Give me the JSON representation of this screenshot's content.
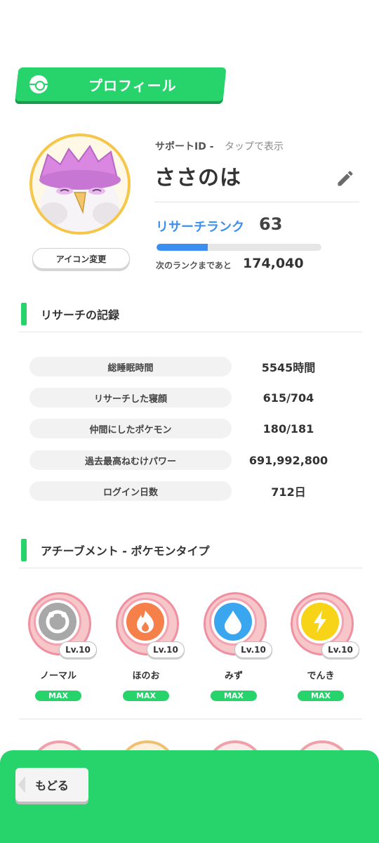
{
  "header": {
    "title": "プロフィール",
    "icon": "pokeball-icon"
  },
  "profile": {
    "support_id_label": "サポートID -",
    "support_id_tap": "タップで表示",
    "name": "ささのは",
    "icon_change_label": "アイコン変更",
    "rank_label": "リサーチランク",
    "rank_value": "63",
    "rank_progress": 0.31,
    "next_rank_label": "次のランクまであと",
    "next_rank_value": "174,040"
  },
  "records": {
    "title": "リサーチの記録",
    "rows": [
      {
        "label": "総睡眠時間",
        "value": "5545時間"
      },
      {
        "label": "リサーチした寝顔",
        "value": "615/704"
      },
      {
        "label": "仲間にしたポケモン",
        "value": "180/181"
      },
      {
        "label": "過去最高ねむけパワー",
        "value": "691,992,800"
      },
      {
        "label": "ログイン日数",
        "value": "712日"
      }
    ]
  },
  "achievements": {
    "title": "アチーブメント - ポケモンタイプ",
    "items": [
      {
        "type": "ノーマル",
        "level": "Lv.10",
        "status": "MAX",
        "color": "#a8a8a8",
        "icon": "normal-type-icon"
      },
      {
        "type": "ほのお",
        "level": "Lv.10",
        "status": "MAX",
        "color": "#f5804a",
        "icon": "fire-type-icon"
      },
      {
        "type": "みず",
        "level": "Lv.10",
        "status": "MAX",
        "color": "#3ba6f0",
        "icon": "water-type-icon"
      },
      {
        "type": "でんき",
        "level": "Lv.10",
        "status": "MAX",
        "color": "#f7d417",
        "icon": "electric-type-icon"
      }
    ]
  },
  "footer": {
    "back_label": "もどる"
  },
  "colors": {
    "accent": "#27d46c",
    "rank_blue": "#3b8ff0"
  }
}
